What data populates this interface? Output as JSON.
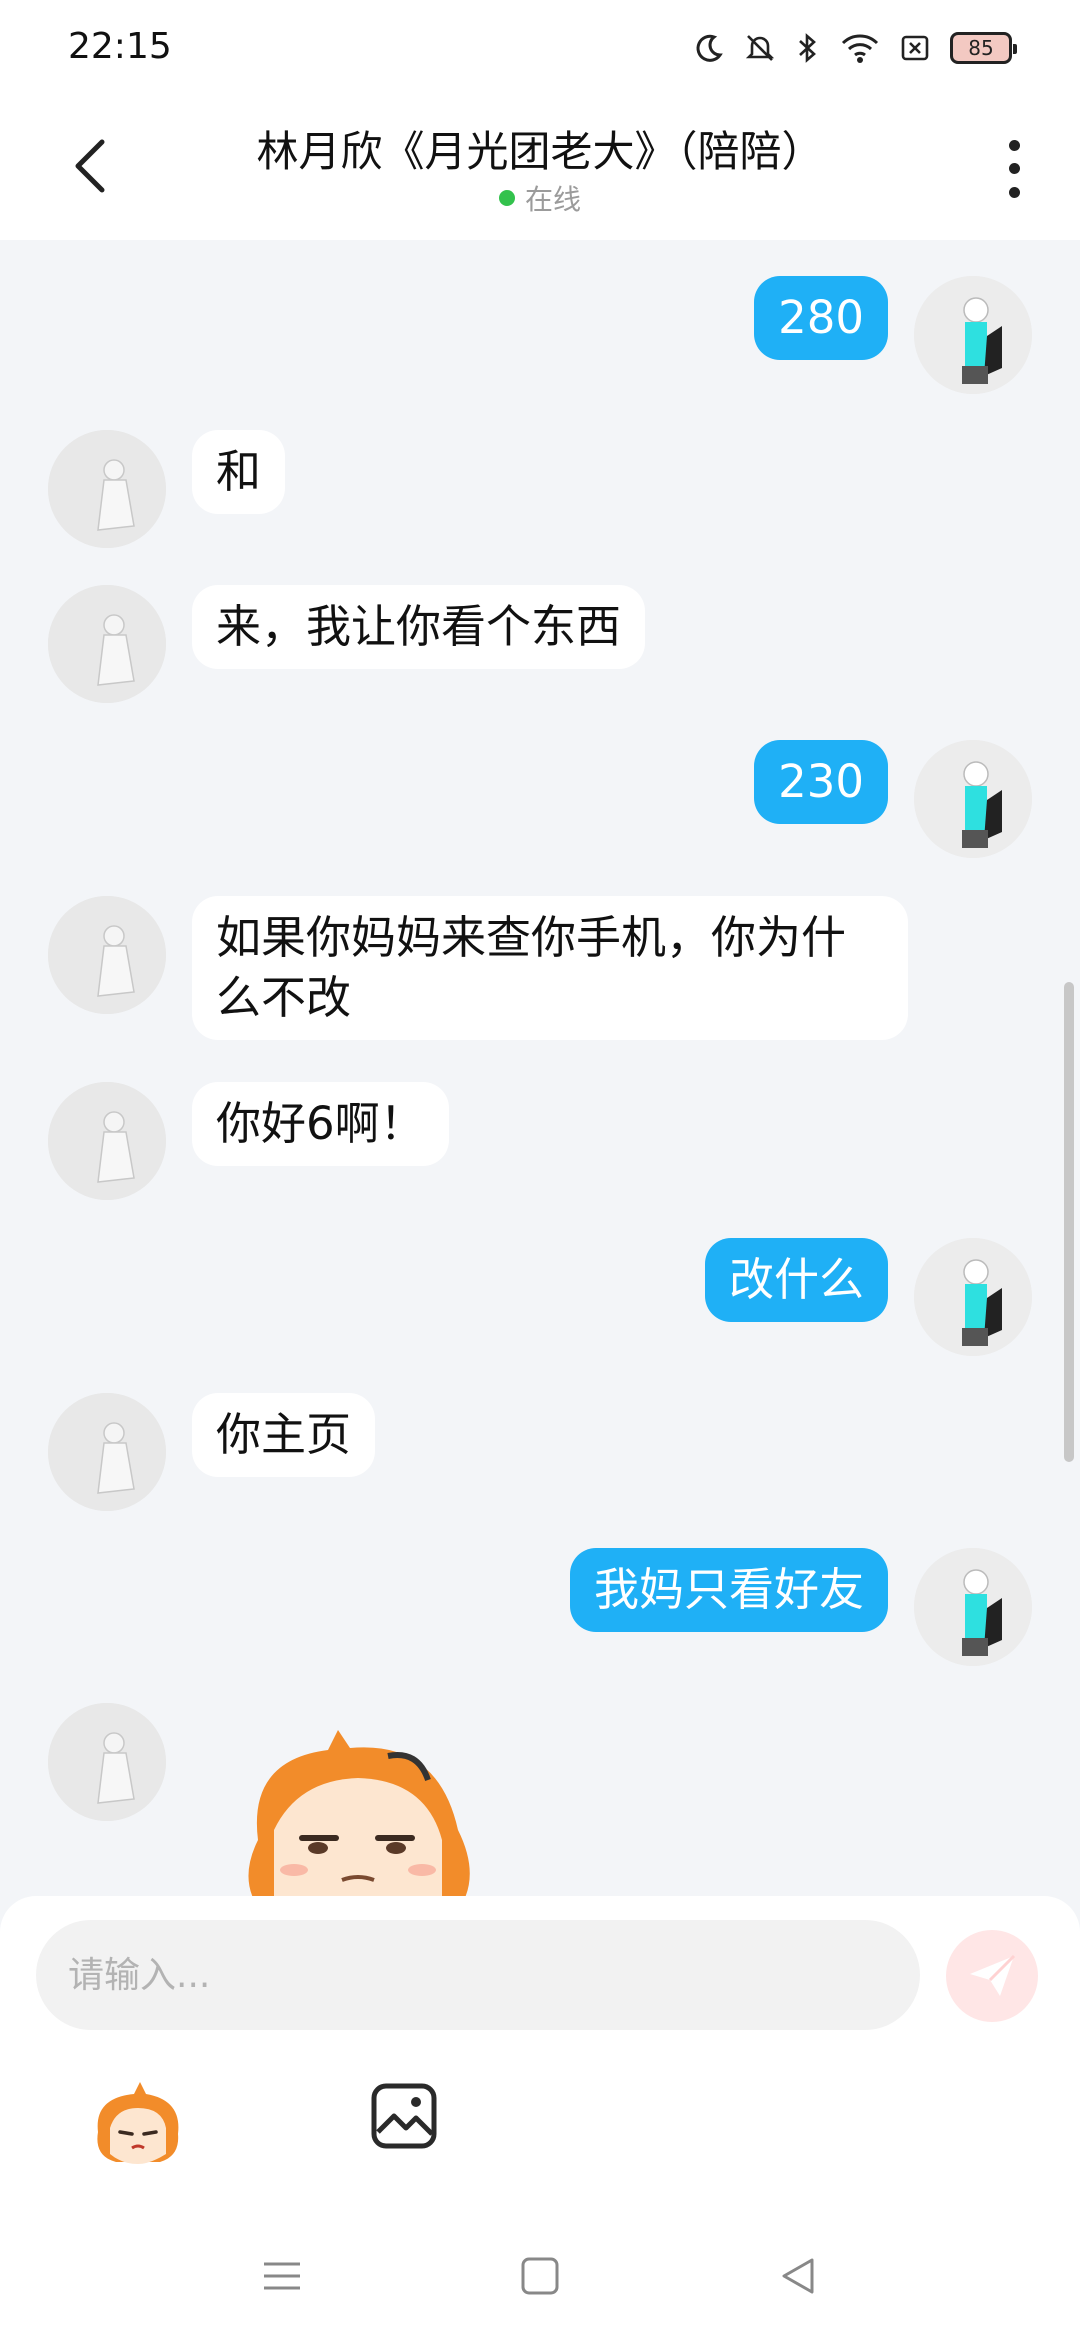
{
  "status_bar": {
    "time": "22:15",
    "battery": "85",
    "icons": [
      "moon-icon",
      "mute-bell-icon",
      "bluetooth-icon",
      "wifi-icon",
      "sim-off-icon",
      "battery-icon"
    ]
  },
  "header": {
    "title": "林月欣《月光团老大》（陪陪）",
    "status": "在线",
    "status_color": "#33c24d"
  },
  "messages": [
    {
      "side": "out",
      "text": "280"
    },
    {
      "side": "in",
      "text": "和"
    },
    {
      "side": "in",
      "text": "来，我让你看个东西"
    },
    {
      "side": "out",
      "text": "230"
    },
    {
      "side": "in",
      "text": "如果你妈妈来查你手机，你为什么不改"
    },
    {
      "side": "in",
      "text": "你好6啊！"
    },
    {
      "side": "out",
      "text": "改什么"
    },
    {
      "side": "in",
      "text": "你主页"
    },
    {
      "side": "out",
      "text": "我妈只看好友"
    },
    {
      "side": "in",
      "type": "sticker",
      "text": ""
    }
  ],
  "input": {
    "placeholder": "请输入...",
    "value": ""
  },
  "toolbar": {
    "emoji_icon": "sticker-face-icon",
    "image_icon": "image-icon",
    "send_icon": "send-icon"
  },
  "colors": {
    "outgoing_bubble": "#1fb0f6",
    "incoming_bubble": "#ffffff",
    "chat_background": "#f3f5f8",
    "send_button": "#ffe6e6"
  }
}
